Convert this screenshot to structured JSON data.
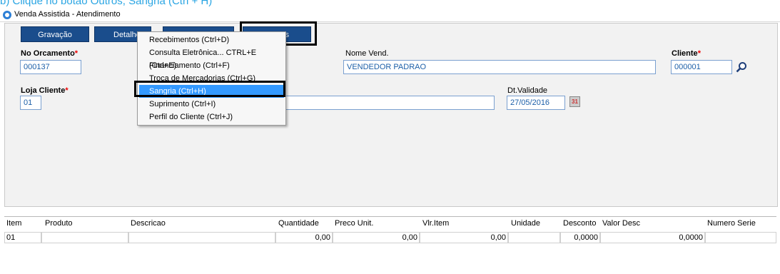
{
  "caption": "b)   Clique no botão Outros, Sangria (Ctrl + H)",
  "window": {
    "title": "Venda Assistida - Atendimento"
  },
  "toolbar": {
    "gravacao": "Gravação",
    "detalhes": "Detalhe",
    "outros": "s"
  },
  "form": {
    "no_orcamento": {
      "label": "No Orcamento",
      "value": "000137"
    },
    "nome_vend": {
      "label": "Nome Vend.",
      "value": "VENDEDOR PADRAO"
    },
    "cliente": {
      "label": "Cliente",
      "value": "000001"
    },
    "loja_cliente": {
      "label": "Loja Cliente",
      "value": "01"
    },
    "dt_validade": {
      "label": "Dt.Validade",
      "value": "27/05/2016"
    },
    "required_mark": "*",
    "calendar_icon": "31"
  },
  "menu": {
    "items": [
      "Recebimentos (Ctrl+D)",
      "Consulta Eletrônica... CTRL+E (Ctrl+E)",
      "Financiamento (Ctrl+F)",
      "Troca de Mercadorias (Ctrl+G)",
      "Sangria (Ctrl+H)",
      "Suprimento (Ctrl+I)",
      "Perfil do Cliente (Ctrl+J)"
    ],
    "selected_index": 4
  },
  "grid": {
    "columns": [
      "Item",
      "Produto",
      "Descricao",
      "Quantidade",
      "Preco Unit.",
      "Vlr.Item",
      "Unidade",
      "Desconto",
      "Valor Desc",
      "Numero Serie"
    ],
    "rows": [
      {
        "item": "01",
        "produto": "",
        "descricao": "",
        "quantidade": "0,00",
        "preco_unit": "0,00",
        "vlr_item": "0,00",
        "unidade": "",
        "desconto": "0,0000",
        "valor_desc": "0,0000",
        "numero_serie": ""
      }
    ]
  },
  "colors": {
    "accent": "#1a4d8c",
    "selection": "#3399ff",
    "caption": "#2aa5e3",
    "input_text": "#1c5fa8"
  }
}
